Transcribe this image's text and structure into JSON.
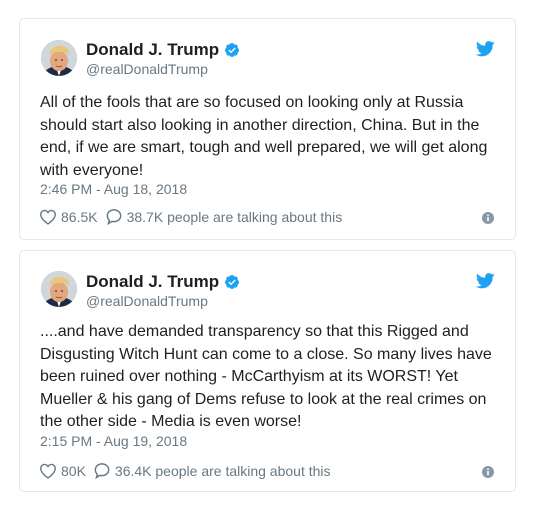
{
  "tweets": [
    {
      "author_name": "Donald J. Trump",
      "handle": "@realDonaldTrump",
      "text": "All of the fools that are so focused on looking only at Russia should start also looking in another direction, China. But in the end, if we are smart, tough and well prepared, we will get along with everyone!",
      "timestamp": "2:46 PM - Aug 18, 2018",
      "likes": "86.5K",
      "talking": "38.7K people are talking about this",
      "icons": {
        "verified": "verified-badge-icon",
        "bird": "twitter-bird-icon",
        "like": "heart-icon",
        "reply": "speech-bubble-icon",
        "info": "info-icon"
      }
    },
    {
      "author_name": "Donald J. Trump",
      "handle": "@realDonaldTrump",
      "text": "....and have demanded transparency so that this Rigged and Disgusting Witch Hunt can come to a close. So many lives have been ruined over nothing - McCarthyism at its WORST! Yet Mueller & his gang of Dems refuse to look at the real crimes on the other side - Media is even worse!",
      "timestamp": "2:15 PM - Aug 19, 2018",
      "likes": "80K",
      "talking": "36.4K people are talking about this",
      "icons": {
        "verified": "verified-badge-icon",
        "bird": "twitter-bird-icon",
        "like": "heart-icon",
        "reply": "speech-bubble-icon",
        "info": "info-icon"
      }
    }
  ],
  "colors": {
    "twitter_blue": "#1da1f2",
    "text": "#1c2022",
    "muted": "#697882",
    "border": "#e1e8ed",
    "info_gray": "#8899a6"
  }
}
